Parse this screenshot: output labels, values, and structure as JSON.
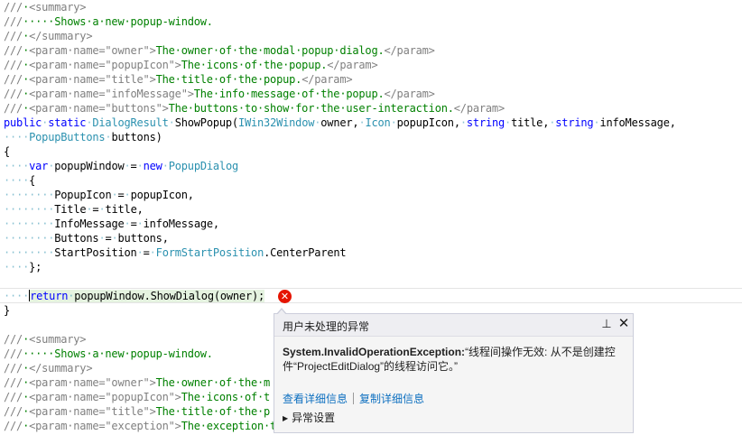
{
  "code_lines": [
    "///·<summary>",
    "///·····Shows·a·new·popup-window.",
    "///·</summary>",
    "///·<param·name=\"owner\">The·owner·of·the·modal·popup·dialog.</param>",
    "///·<param·name=\"popupIcon\">The·icons·of·the·popup.</param>",
    "///·<param·name=\"title\">The·title·of·the·popup.</param>",
    "///·<param·name=\"infoMessage\">The·info·message·of·the·popup.</param>",
    "///·<param·name=\"buttons\">The·buttons·to·show·for·the·user-interaction.</param>",
    "public·static·DialogResult·ShowPopup(IWin32Window·owner,·Icon·popupIcon,·string·title,·string·infoMessage,",
    "····PopupButtons·buttons)",
    "{",
    "····var·popupWindow·=·new·PopupDialog",
    "····{",
    "········PopupIcon·=·popupIcon,",
    "········Title·=·title,",
    "········InfoMessage·=·infoMessage,",
    "········Buttons·=·buttons,",
    "········StartPosition·=·FormStartPosition.CenterParent",
    "····};",
    "",
    "····return·popupWindow.ShowDialog(owner);",
    "}",
    "",
    "///·<summary>",
    "///·····Shows·a·new·popup-window.",
    "///·</summary>",
    "///·<param·name=\"owner\">The·owner·of·the·m",
    "///·<param·name=\"popupIcon\">The·icons·of·t",
    "///·<param·name=\"title\">The·title·of·the·p",
    "///·<param·name=\"exception\">The·exception·t"
  ],
  "exception_popup": {
    "title": "用户未处理的异常",
    "pin_icon": "pin-icon",
    "close_icon": "close-icon",
    "exception_type": "System.InvalidOperationException:",
    "message": "“线程间操作无效: 从不是创建控件“ProjectEditDialog”的线程访问它。”",
    "view_details_link": "查看详细信息",
    "copy_details_link": "复制详细信息",
    "exception_settings": "异常设置"
  },
  "error_glyph": "error-icon",
  "colors": {
    "comment": "#008000",
    "xml_doc": "#808080",
    "keyword": "#0000ff",
    "type": "#2b91af",
    "error": "#e51400",
    "link": "#0e70c0"
  }
}
